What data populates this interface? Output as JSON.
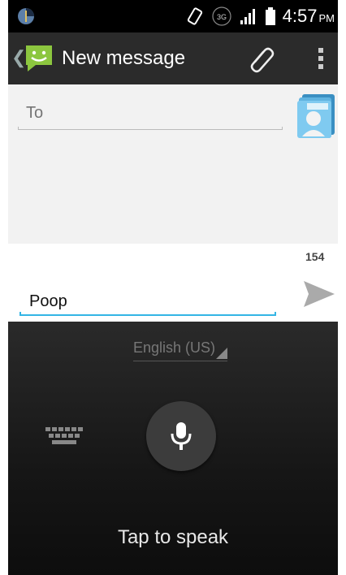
{
  "status_bar": {
    "time": "4:57",
    "ampm": "PM",
    "network": "3G"
  },
  "action_bar": {
    "title": "New message"
  },
  "recipient": {
    "placeholder": "To"
  },
  "message": {
    "char_count": "154",
    "value": "Poop"
  },
  "voice_input": {
    "language": "English (US)",
    "prompt": "Tap to speak"
  },
  "colors": {
    "accent": "#33b5e5",
    "app_icon": "#8cc63f"
  }
}
